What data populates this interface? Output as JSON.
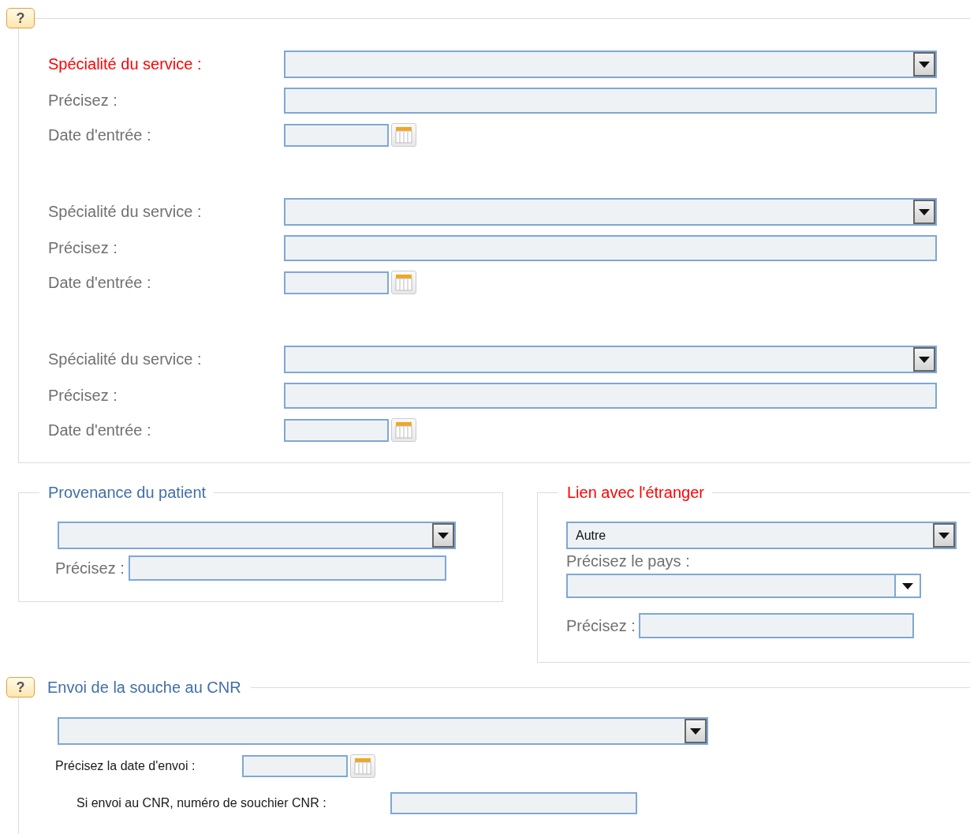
{
  "services": {
    "help": "?",
    "groups": [
      {
        "specialty_label": "Spécialité du service :",
        "required": true,
        "precisez_label": "Précisez :",
        "date_label": "Date d'entrée :"
      },
      {
        "specialty_label": "Spécialité du service :",
        "required": false,
        "precisez_label": "Précisez :",
        "date_label": "Date d'entrée :"
      },
      {
        "specialty_label": "Spécialité du service :",
        "required": false,
        "precisez_label": "Précisez :",
        "date_label": "Date d'entrée :"
      }
    ]
  },
  "provenance": {
    "legend": "Provenance du patient",
    "required": false,
    "precisez_label": "Précisez :"
  },
  "lien": {
    "legend": "Lien avec l'étranger",
    "required": true,
    "value": "Autre",
    "pays_label": "Précisez le pays :",
    "precisez_label": "Précisez :"
  },
  "envoi": {
    "help": "?",
    "legend": "Envoi de la souche au CNR",
    "date_label": "Précisez la date d'envoi :",
    "cnr_label": "Si envoi au CNR, numéro de souchier CNR :"
  }
}
